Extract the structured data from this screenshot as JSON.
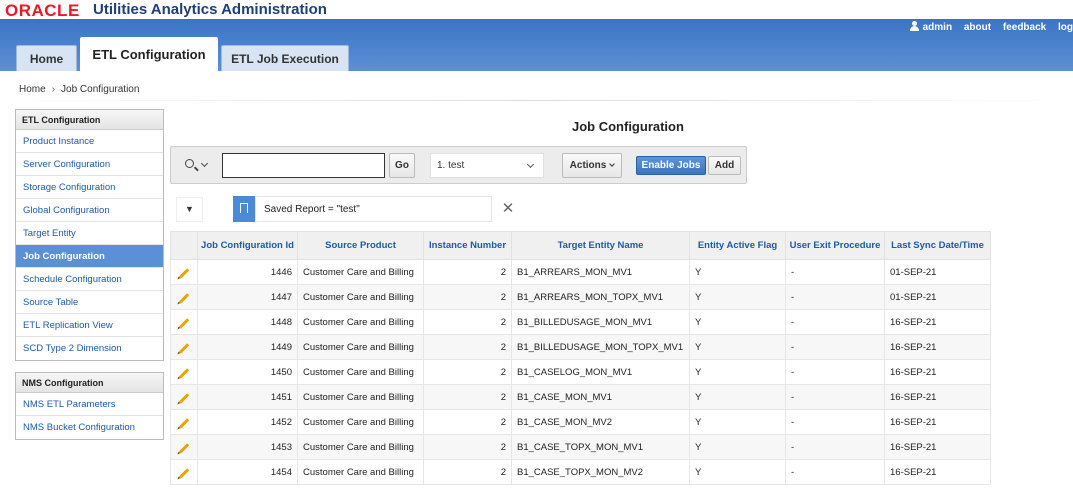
{
  "header": {
    "logo": "ORACLE",
    "app_title": "Utilities Analytics Administration",
    "user": "admin",
    "links": [
      "about",
      "feedback",
      "log"
    ]
  },
  "tabs": [
    "Home",
    "ETL Configuration",
    "ETL Job Execution"
  ],
  "breadcrumb": [
    "Home",
    "Job Configuration"
  ],
  "sidebar": {
    "etl_title": "ETL Configuration",
    "etl_items": [
      "Product Instance",
      "Server Configuration",
      "Storage Configuration",
      "Global Configuration",
      "Target Entity",
      "Job Configuration",
      "Schedule Configuration",
      "Source Table",
      "ETL Replication View",
      "SCD Type 2 Dimension"
    ],
    "nms_title": "NMS Configuration",
    "nms_items": [
      "NMS ETL Parameters",
      "NMS Bucket Configuration"
    ]
  },
  "main": {
    "title": "Job Configuration",
    "search_value": "",
    "go_label": "Go",
    "report_select": "1. test",
    "actions_label": "Actions",
    "enable_label": "Enable Jobs",
    "add_label": "Add",
    "saved_report": "Saved Report = \"test\"",
    "close_glyph": "✕",
    "toggle_glyph": "▼"
  },
  "table": {
    "columns": [
      "",
      "Job Configuration Id",
      "Source Product",
      "Instance Number",
      "Target Entity Name",
      "Entity Active Flag",
      "User Exit Procedure",
      "Last Sync Date/Time"
    ],
    "rows": [
      [
        "1446",
        "Customer Care and Billing",
        "2",
        "B1_ARREARS_MON_MV1",
        "Y",
        "-",
        "01-SEP-21"
      ],
      [
        "1447",
        "Customer Care and Billing",
        "2",
        "B1_ARREARS_MON_TOPX_MV1",
        "Y",
        "-",
        "01-SEP-21"
      ],
      [
        "1448",
        "Customer Care and Billing",
        "2",
        "B1_BILLEDUSAGE_MON_MV1",
        "Y",
        "-",
        "16-SEP-21"
      ],
      [
        "1449",
        "Customer Care and Billing",
        "2",
        "B1_BILLEDUSAGE_MON_TOPX_MV1",
        "Y",
        "-",
        "16-SEP-21"
      ],
      [
        "1450",
        "Customer Care and Billing",
        "2",
        "B1_CASELOG_MON_MV1",
        "Y",
        "-",
        "16-SEP-21"
      ],
      [
        "1451",
        "Customer Care and Billing",
        "2",
        "B1_CASE_MON_MV1",
        "Y",
        "-",
        "16-SEP-21"
      ],
      [
        "1452",
        "Customer Care and Billing",
        "2",
        "B1_CASE_MON_MV2",
        "Y",
        "-",
        "16-SEP-21"
      ],
      [
        "1453",
        "Customer Care and Billing",
        "2",
        "B1_CASE_TOPX_MON_MV1",
        "Y",
        "-",
        "16-SEP-21"
      ],
      [
        "1454",
        "Customer Care and Billing",
        "2",
        "B1_CASE_TOPX_MON_MV2",
        "Y",
        "-",
        "16-SEP-21"
      ]
    ]
  }
}
